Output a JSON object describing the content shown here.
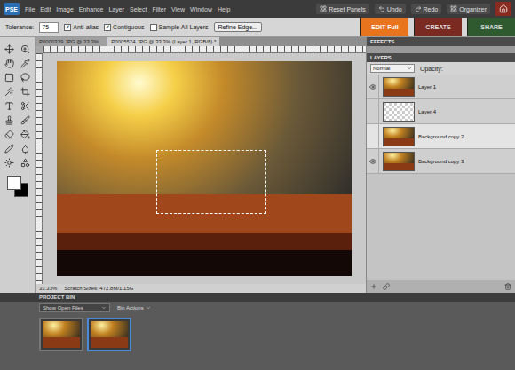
{
  "app": {
    "logo": "PSE",
    "menus": [
      "File",
      "Edit",
      "Image",
      "Enhance",
      "Layer",
      "Select",
      "Filter",
      "View",
      "Window",
      "Help"
    ],
    "actions": [
      "Reset Panels",
      "Undo",
      "Redo",
      "Organizer"
    ]
  },
  "options_bar": {
    "tolerance_label": "Tolerance:",
    "tolerance": "75",
    "checkboxes": [
      {
        "label": "Anti-alias",
        "checked": true
      },
      {
        "label": "Contiguous",
        "checked": true
      },
      {
        "label": "Sample All Layers",
        "checked": false
      }
    ],
    "button": "Refine Edge..."
  },
  "modes": [
    {
      "label": "EDIT Full",
      "selected": true,
      "color": "#e8741e"
    },
    {
      "label": "CREATE",
      "selected": false,
      "color": "#7a2a20"
    },
    {
      "label": "SHARE",
      "selected": false,
      "color": "#2f5a30"
    }
  ],
  "document": {
    "tabs": [
      {
        "label": "P0000339.JPG @ 33.3%...",
        "selected": false
      },
      {
        "label": "P0005574.JPG @ 33.3% (Layer 1, RGB/8) *",
        "selected": true
      }
    ],
    "zoom": "33.33%",
    "status": "Scratch Sizes: 472.8M/1.15G"
  },
  "panels": {
    "effects": "EFFECTS",
    "layers": "LAYERS",
    "blend_mode": "Normal",
    "opacity_label": "Opacity:"
  },
  "layers": [
    {
      "name": "Layer 1",
      "visible": true,
      "selected": false,
      "kind": "photo"
    },
    {
      "name": "Layer 4",
      "visible": false,
      "selected": false,
      "kind": "transparent"
    },
    {
      "name": "Background copy 2",
      "visible": false,
      "selected": true,
      "kind": "photo"
    },
    {
      "name": "Background copy 3",
      "visible": true,
      "selected": false,
      "kind": "photo"
    }
  ],
  "project_bin": {
    "title": "PROJECT BIN",
    "source": "Show Open Files",
    "actions": "Bin Actions",
    "thumbnails": [
      {
        "selected": false
      },
      {
        "selected": true
      }
    ]
  }
}
